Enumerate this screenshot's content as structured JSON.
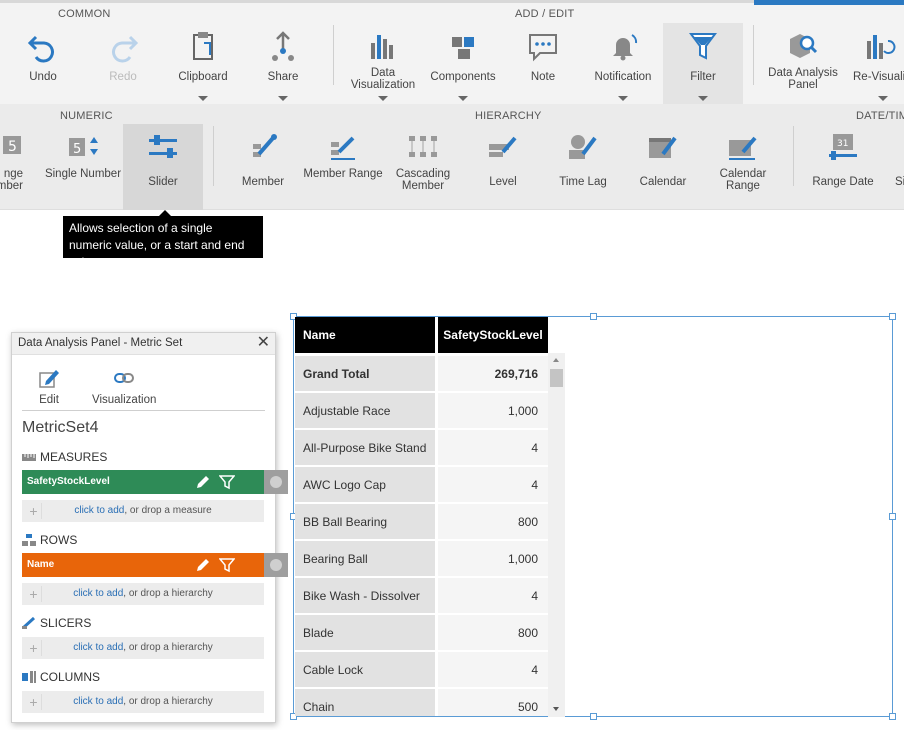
{
  "ribbon": {
    "groups": {
      "common": "COMMON",
      "add_edit": "ADD / EDIT"
    },
    "buttons": {
      "undo": "Undo",
      "redo": "Redo",
      "clipboard": "Clipboard",
      "share": "Share",
      "data_visualization": "Data Visualization",
      "components": "Components",
      "note": "Note",
      "notification": "Notification",
      "filter": "Filter",
      "data_analysis_panel": "Data Analysis Panel",
      "revisualize": "Re-Visualiz"
    }
  },
  "subribbon": {
    "groups": {
      "numeric": "NUMERIC",
      "hierarchy": "HIERARCHY",
      "date_time": "DATE/TIM"
    },
    "buttons": {
      "range_number": "nge\nmber",
      "single_number": "Single Number",
      "slider": "Slider",
      "member": "Member",
      "member_range": "Member Range",
      "cascading_member": "Cascading Member",
      "level": "Level",
      "time_lag": "Time Lag",
      "calendar": "Calendar",
      "calendar_range": "Calendar Range",
      "range_date": "Range Date",
      "single_date": "Si"
    }
  },
  "tooltip": {
    "text": "Allows selection of a single numeric value, or a start and end value."
  },
  "panel": {
    "header": "Data Analysis Panel - Metric Set",
    "tools": {
      "edit": "Edit",
      "visualization": "Visualization"
    },
    "metricset": "MetricSet4",
    "measures": {
      "title": "MEASURES",
      "pill": "SafetyStockLevel",
      "pill_color": "#2e8b57",
      "drop_link": "click to add",
      "drop_rest": ", or drop a measure"
    },
    "rows": {
      "title": "ROWS",
      "pill": "Name",
      "pill_color": "#e8650a",
      "drop_link": "click to add",
      "drop_rest": ", or drop a hierarchy"
    },
    "slicers": {
      "title": "SLICERS",
      "drop_link": "click to add",
      "drop_rest": ", or drop a hierarchy"
    },
    "columns": {
      "title": "COLUMNS",
      "drop_link": "click to add",
      "drop_rest": ", or drop a hierarchy"
    }
  },
  "table": {
    "columns": [
      "Name",
      "SafetyStockLevel"
    ],
    "rows": [
      {
        "name": "Grand Total",
        "value": "269,716"
      },
      {
        "name": "Adjustable Race",
        "value": "1,000"
      },
      {
        "name": "All-Purpose Bike Stand",
        "value": "4"
      },
      {
        "name": "AWC Logo Cap",
        "value": "4"
      },
      {
        "name": "BB Ball Bearing",
        "value": "800"
      },
      {
        "name": "Bearing Ball",
        "value": "1,000"
      },
      {
        "name": "Bike Wash - Dissolver",
        "value": "4"
      },
      {
        "name": "Blade",
        "value": "800"
      },
      {
        "name": "Cable Lock",
        "value": "4"
      },
      {
        "name": "Chain",
        "value": "500"
      }
    ]
  }
}
